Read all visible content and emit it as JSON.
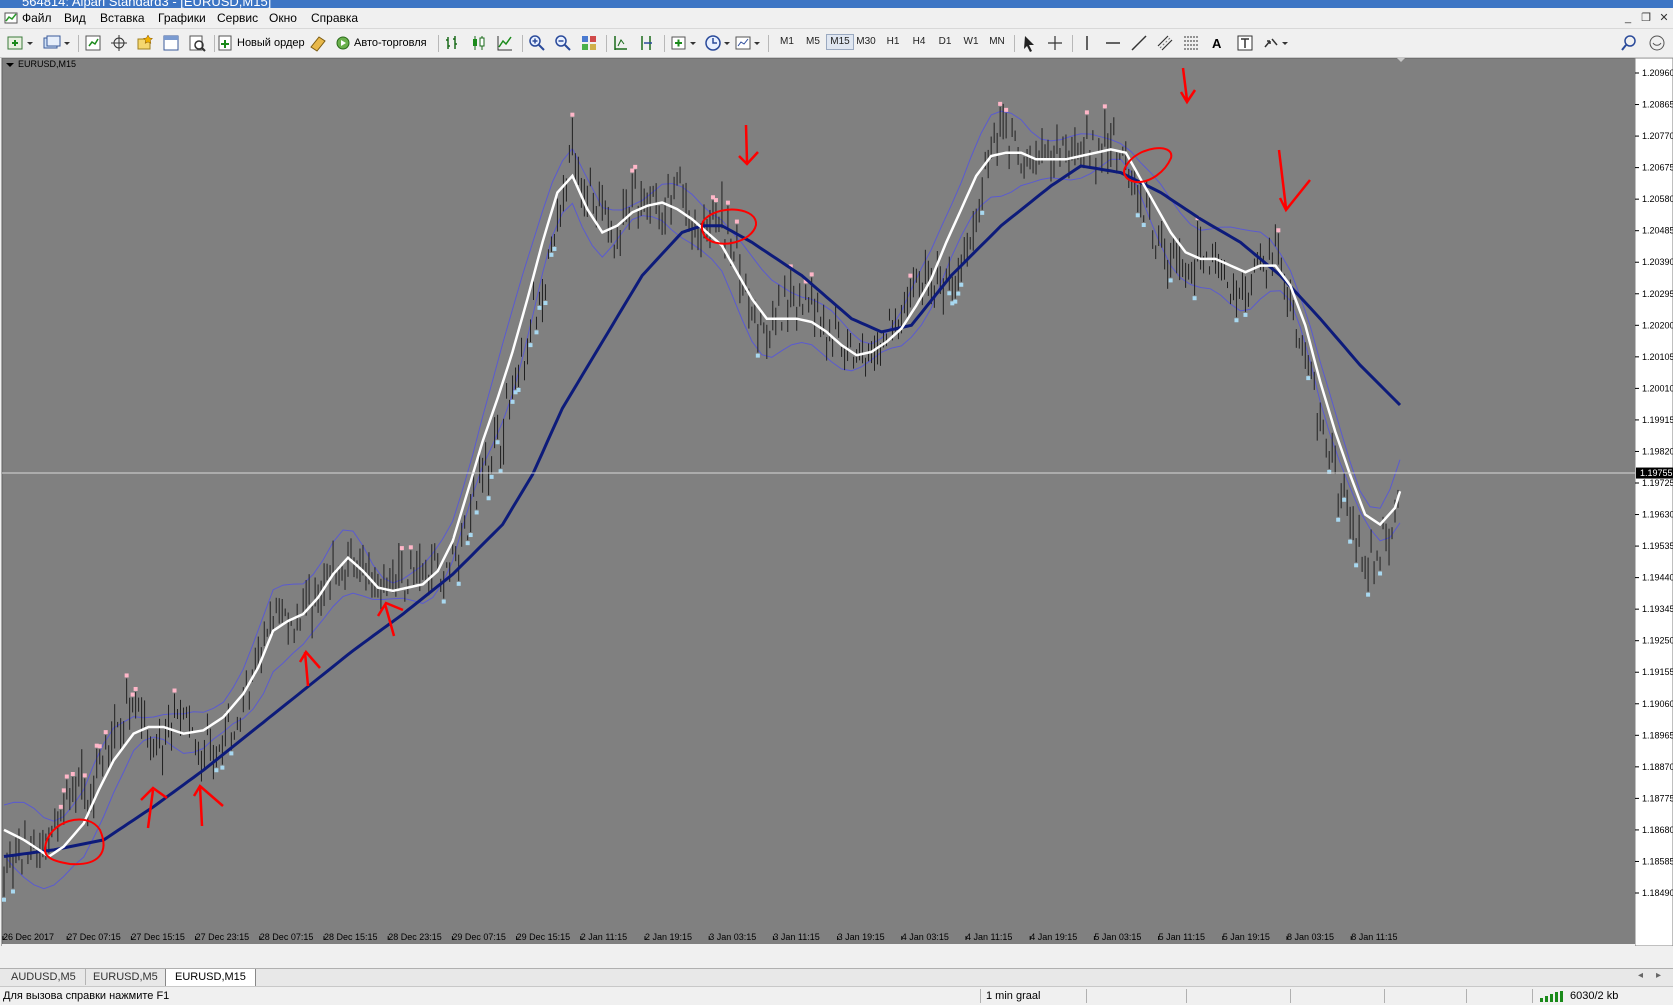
{
  "window": {
    "title": "564814: Alpari Standard3 - [EURUSD,M15]"
  },
  "menu": [
    "Файл",
    "Вид",
    "Вставка",
    "Графики",
    "Сервис",
    "Окно",
    "Справка"
  ],
  "toolbar": {
    "new_order_label": "Новый ордер",
    "auto_trading_label": "Авто-торговля",
    "timeframes": [
      "M1",
      "M5",
      "M15",
      "M30",
      "H1",
      "H4",
      "D1",
      "W1",
      "MN"
    ],
    "active_timeframe": "M15",
    "text_tool_label": "A"
  },
  "chart": {
    "label": "EURUSD,M15",
    "current_price": "1.19755",
    "colors": {
      "background": "#808080",
      "candles": "#202020",
      "fast_ma": "#ffffff",
      "slow_ma": "#0d1b7a",
      "bands": "#5a5ad0",
      "up_signal": "#ffb6c8",
      "down_signal": "#a8d8f0",
      "annotation": "#ff0000"
    }
  },
  "chart_data": {
    "type": "candlestick",
    "symbol": "EURUSD",
    "timeframe": "M15",
    "ylim": [
      1.1849,
      1.2096
    ],
    "price_ticks": [
      "1.20960",
      "1.20865",
      "1.20770",
      "1.20675",
      "1.20580",
      "1.20485",
      "1.20390",
      "1.20295",
      "1.20200",
      "1.20105",
      "1.20010",
      "1.19915",
      "1.19820",
      "1.19725",
      "1.19630",
      "1.19535",
      "1.19440",
      "1.19345",
      "1.19250",
      "1.19155",
      "1.19060",
      "1.18965",
      "1.18870",
      "1.18775",
      "1.18680",
      "1.18585",
      "1.18490"
    ],
    "time_ticks": [
      "26 Dec 2017",
      "27 Dec 07:15",
      "27 Dec 15:15",
      "27 Dec 23:15",
      "28 Dec 07:15",
      "28 Dec 15:15",
      "28 Dec 23:15",
      "29 Dec 07:15",
      "29 Dec 15:15",
      "2 Jan 11:15",
      "2 Jan 19:15",
      "3 Jan 03:15",
      "3 Jan 11:15",
      "3 Jan 19:15",
      "4 Jan 03:15",
      "4 Jan 11:15",
      "4 Jan 19:15",
      "5 Jan 03:15",
      "5 Jan 11:15",
      "5 Jan 19:15",
      "8 Jan 03:15",
      "8 Jan 11:15"
    ],
    "current_price": 1.19755,
    "price_path": [
      [
        0,
        1.1858
      ],
      [
        25,
        1.1861
      ],
      [
        45,
        1.1864
      ],
      [
        62,
        1.1875
      ],
      [
        75,
        1.1885
      ],
      [
        85,
        1.1873
      ],
      [
        100,
        1.1891
      ],
      [
        120,
        1.1902
      ],
      [
        135,
        1.191
      ],
      [
        150,
        1.1886
      ],
      [
        165,
        1.1899
      ],
      [
        180,
        1.1902
      ],
      [
        195,
        1.189
      ],
      [
        210,
        1.1895
      ],
      [
        225,
        1.1896
      ],
      [
        240,
        1.1906
      ],
      [
        255,
        1.1916
      ],
      [
        270,
        1.1933
      ],
      [
        285,
        1.1932
      ],
      [
        300,
        1.1934
      ],
      [
        315,
        1.194
      ],
      [
        330,
        1.1944
      ],
      [
        345,
        1.1949
      ],
      [
        360,
        1.1952
      ],
      [
        375,
        1.1942
      ],
      [
        390,
        1.1945
      ],
      [
        405,
        1.1944
      ],
      [
        420,
        1.1944
      ],
      [
        435,
        1.1947
      ],
      [
        450,
        1.1948
      ],
      [
        465,
        1.196
      ],
      [
        480,
        1.1976
      ],
      [
        495,
        1.1985
      ],
      [
        510,
        1.1999
      ],
      [
        525,
        1.2015
      ],
      [
        540,
        1.203
      ],
      [
        555,
        1.2047
      ],
      [
        570,
        1.2075
      ],
      [
        585,
        1.206
      ],
      [
        600,
        1.2053
      ],
      [
        615,
        1.2045
      ],
      [
        630,
        1.2058
      ],
      [
        645,
        1.206
      ],
      [
        660,
        1.2055
      ],
      [
        675,
        1.206
      ],
      [
        690,
        1.2051
      ],
      [
        705,
        1.2047
      ],
      [
        720,
        1.2052
      ],
      [
        735,
        1.2039
      ],
      [
        750,
        1.2025
      ],
      [
        765,
        1.2015
      ],
      [
        780,
        1.2022
      ],
      [
        795,
        1.2027
      ],
      [
        810,
        1.203
      ],
      [
        825,
        1.2017
      ],
      [
        840,
        1.2014
      ],
      [
        855,
        1.201
      ],
      [
        870,
        1.2009
      ],
      [
        885,
        1.2017
      ],
      [
        900,
        1.202
      ],
      [
        915,
        1.2034
      ],
      [
        930,
        1.2035
      ],
      [
        945,
        1.203
      ],
      [
        960,
        1.2038
      ],
      [
        975,
        1.2055
      ],
      [
        990,
        1.2073
      ],
      [
        1005,
        1.2079
      ],
      [
        1020,
        1.2068
      ],
      [
        1035,
        1.2071
      ],
      [
        1050,
        1.2069
      ],
      [
        1065,
        1.2072
      ],
      [
        1080,
        1.2073
      ],
      [
        1095,
        1.207
      ],
      [
        1110,
        1.2076
      ],
      [
        1125,
        1.2072
      ],
      [
        1140,
        1.206
      ],
      [
        1155,
        1.2045
      ],
      [
        1170,
        1.204
      ],
      [
        1185,
        1.2035
      ],
      [
        1200,
        1.204
      ],
      [
        1215,
        1.2037
      ],
      [
        1230,
        1.203
      ],
      [
        1245,
        1.2032
      ],
      [
        1260,
        1.2038
      ],
      [
        1275,
        1.2045
      ],
      [
        1290,
        1.2025
      ],
      [
        1305,
        1.201
      ],
      [
        1320,
        1.199
      ],
      [
        1335,
        1.1975
      ],
      [
        1350,
        1.196
      ],
      [
        1365,
        1.1945
      ],
      [
        1380,
        1.1955
      ],
      [
        1395,
        1.196
      ],
      [
        1400,
        1.1975
      ]
    ],
    "fast_ma": [
      [
        0,
        1.1868
      ],
      [
        20,
        1.1865
      ],
      [
        45,
        1.186
      ],
      [
        60,
        1.1863
      ],
      [
        80,
        1.187
      ],
      [
        95,
        1.188
      ],
      [
        110,
        1.1889
      ],
      [
        130,
        1.1897
      ],
      [
        145,
        1.1899
      ],
      [
        160,
        1.1899
      ],
      [
        180,
        1.1897
      ],
      [
        200,
        1.1898
      ],
      [
        220,
        1.1902
      ],
      [
        240,
        1.1909
      ],
      [
        255,
        1.1917
      ],
      [
        270,
        1.1928
      ],
      [
        285,
        1.1931
      ],
      [
        300,
        1.1933
      ],
      [
        315,
        1.1938
      ],
      [
        330,
        1.1945
      ],
      [
        345,
        1.195
      ],
      [
        360,
        1.1946
      ],
      [
        375,
        1.1941
      ],
      [
        390,
        1.194
      ],
      [
        405,
        1.1941
      ],
      [
        420,
        1.1942
      ],
      [
        435,
        1.1946
      ],
      [
        450,
        1.1955
      ],
      [
        465,
        1.197
      ],
      [
        480,
        1.1985
      ],
      [
        495,
        1.1998
      ],
      [
        510,
        1.2012
      ],
      [
        525,
        1.2028
      ],
      [
        540,
        1.2045
      ],
      [
        555,
        1.206
      ],
      [
        570,
        1.2065
      ],
      [
        585,
        1.2055
      ],
      [
        600,
        1.2048
      ],
      [
        615,
        1.205
      ],
      [
        630,
        1.2054
      ],
      [
        645,
        1.2056
      ],
      [
        660,
        1.2057
      ],
      [
        675,
        1.2055
      ],
      [
        690,
        1.2052
      ],
      [
        705,
        1.2048
      ],
      [
        720,
        1.2044
      ],
      [
        735,
        1.2036
      ],
      [
        750,
        1.2028
      ],
      [
        765,
        1.2022
      ],
      [
        780,
        1.2022
      ],
      [
        795,
        1.2022
      ],
      [
        810,
        1.2021
      ],
      [
        825,
        1.2018
      ],
      [
        840,
        1.2014
      ],
      [
        855,
        1.2011
      ],
      [
        870,
        1.2012
      ],
      [
        885,
        1.2015
      ],
      [
        900,
        1.2019
      ],
      [
        915,
        1.2026
      ],
      [
        930,
        1.2034
      ],
      [
        945,
        1.2045
      ],
      [
        960,
        1.2055
      ],
      [
        975,
        1.2065
      ],
      [
        990,
        1.2071
      ],
      [
        1005,
        1.2072
      ],
      [
        1020,
        1.2072
      ],
      [
        1035,
        1.207
      ],
      [
        1050,
        1.207
      ],
      [
        1065,
        1.207
      ],
      [
        1080,
        1.2071
      ],
      [
        1095,
        1.2072
      ],
      [
        1110,
        1.2073
      ],
      [
        1125,
        1.2072
      ],
      [
        1140,
        1.2064
      ],
      [
        1155,
        1.2056
      ],
      [
        1170,
        1.2048
      ],
      [
        1185,
        1.2042
      ],
      [
        1200,
        1.204
      ],
      [
        1215,
        1.204
      ],
      [
        1230,
        1.2038
      ],
      [
        1245,
        1.2036
      ],
      [
        1260,
        1.2038
      ],
      [
        1275,
        1.2038
      ],
      [
        1290,
        1.2032
      ],
      [
        1305,
        1.202
      ],
      [
        1320,
        1.2003
      ],
      [
        1335,
        1.1988
      ],
      [
        1350,
        1.1975
      ],
      [
        1365,
        1.1963
      ],
      [
        1380,
        1.196
      ],
      [
        1395,
        1.1965
      ],
      [
        1400,
        1.197
      ]
    ],
    "slow_ma": [
      [
        0,
        1.186
      ],
      [
        50,
        1.1862
      ],
      [
        100,
        1.1865
      ],
      [
        150,
        1.1875
      ],
      [
        200,
        1.1886
      ],
      [
        250,
        1.1898
      ],
      [
        300,
        1.191
      ],
      [
        350,
        1.1922
      ],
      [
        400,
        1.1933
      ],
      [
        450,
        1.1945
      ],
      [
        500,
        1.196
      ],
      [
        530,
        1.1975
      ],
      [
        560,
        1.1995
      ],
      [
        600,
        1.2015
      ],
      [
        640,
        1.2035
      ],
      [
        680,
        1.2048
      ],
      [
        700,
        1.205
      ],
      [
        720,
        1.205
      ],
      [
        750,
        1.2045
      ],
      [
        800,
        1.2035
      ],
      [
        850,
        1.2022
      ],
      [
        880,
        1.2018
      ],
      [
        910,
        1.202
      ],
      [
        950,
        1.2035
      ],
      [
        1000,
        1.205
      ],
      [
        1050,
        1.2062
      ],
      [
        1080,
        1.2068
      ],
      [
        1120,
        1.2066
      ],
      [
        1160,
        1.206
      ],
      [
        1200,
        1.2052
      ],
      [
        1240,
        1.2045
      ],
      [
        1280,
        1.2035
      ],
      [
        1320,
        1.2022
      ],
      [
        1360,
        1.2008
      ],
      [
        1400,
        1.1996
      ]
    ]
  },
  "tabs": [
    "AUDUSD,M5",
    "EURUSD,M5",
    "EURUSD,M15"
  ],
  "active_tab": "EURUSD,M15",
  "status": {
    "help": "Для вызова справки нажмите F1",
    "profile": "1 min graal",
    "traffic": "6030/2 kb"
  }
}
